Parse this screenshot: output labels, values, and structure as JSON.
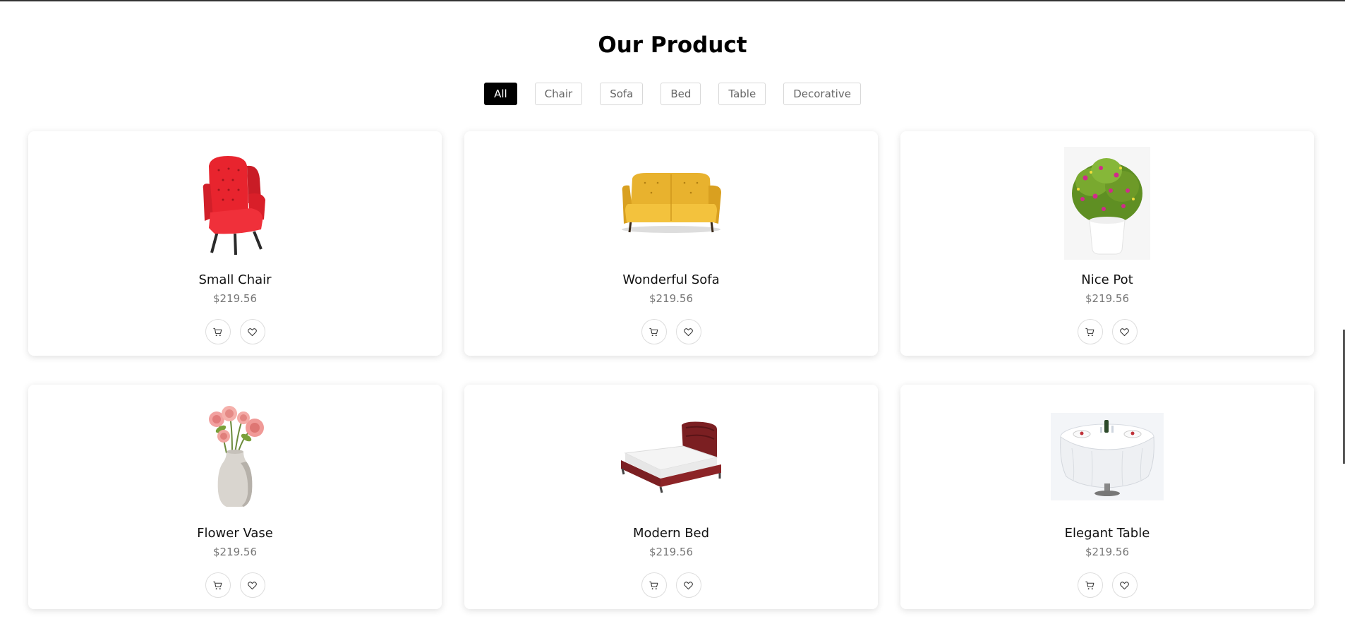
{
  "section": {
    "title": "Our Product"
  },
  "filters": [
    {
      "label": "All",
      "active": true
    },
    {
      "label": "Chair",
      "active": false
    },
    {
      "label": "Sofa",
      "active": false
    },
    {
      "label": "Bed",
      "active": false
    },
    {
      "label": "Table",
      "active": false
    },
    {
      "label": "Decorative",
      "active": false
    }
  ],
  "products": [
    {
      "name": "Small Chair",
      "price": "$219.56",
      "image": "red-armchair"
    },
    {
      "name": "Wonderful Sofa",
      "price": "$219.56",
      "image": "yellow-sofa"
    },
    {
      "name": "Nice Pot",
      "price": "$219.56",
      "image": "potted-plant"
    },
    {
      "name": "Flower Vase",
      "price": "$219.56",
      "image": "rose-vase"
    },
    {
      "name": "Modern Bed",
      "price": "$219.56",
      "image": "maroon-bed"
    },
    {
      "name": "Elegant Table",
      "price": "$219.56",
      "image": "round-dining-table"
    }
  ],
  "icons": {
    "cart": "cart-icon",
    "wishlist": "heart-icon"
  },
  "colors": {
    "active_filter_bg": "#000000",
    "price_text": "#777777"
  }
}
